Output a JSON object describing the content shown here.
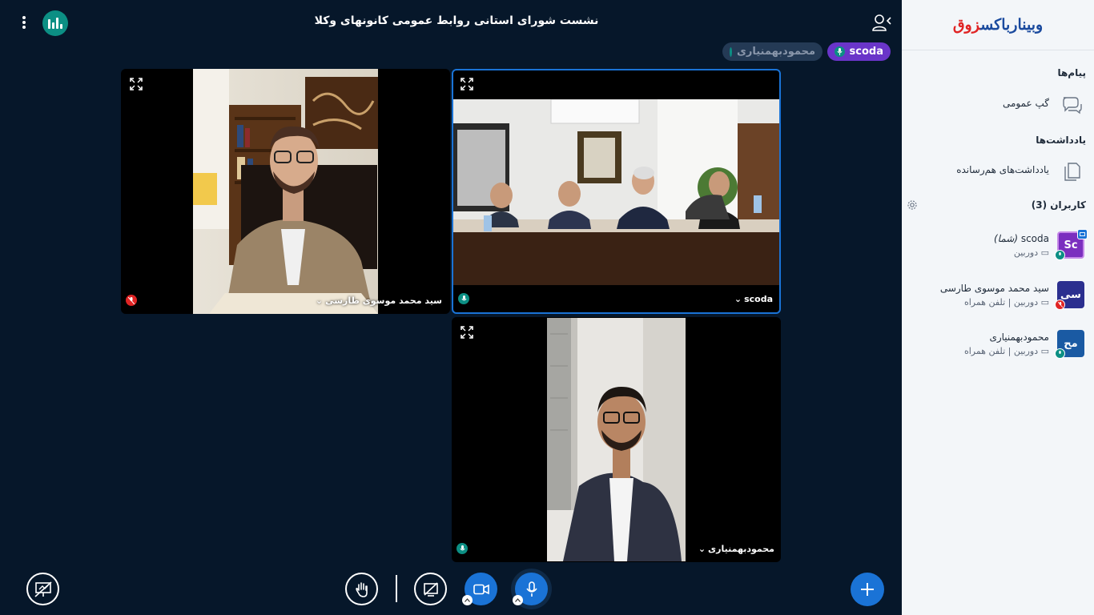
{
  "meeting": {
    "title": "نشست شورای استانی روابط عمومی کانونهای وکلا"
  },
  "talking": {
    "first": "scoda",
    "second": "محمودبهمنیاری"
  },
  "tiles": {
    "sayed": {
      "name": "سید محمد موسوی طارسی",
      "mic": "muted"
    },
    "scoda": {
      "name": "scoda",
      "mic": "on"
    },
    "mahmoud": {
      "name": "محمودبهمنیاری",
      "mic": "on"
    }
  },
  "sidebar": {
    "logo_main": "وبینارباکس",
    "logo_prefix": "زوق",
    "messages_title": "پیام‌ها",
    "public_chat": "گپ عمومی",
    "notes_title": "یادداشت‌ها",
    "shared_notes": "یادداشت‌های هم‌رسانده",
    "users_title": "کاربران (3)",
    "users": [
      {
        "initials": "Sc",
        "name": "scoda",
        "you": "(شما)",
        "sub": "دوربین",
        "color": "#7b2fbf"
      },
      {
        "initials": "سی",
        "name": "سید محمد موسوی طارسی",
        "sub": "دوربین | تلفن همراه",
        "color": "#2b2f8f"
      },
      {
        "initials": "مح",
        "name": "محمودبهمنیاری",
        "sub": "دوربین | تلفن همراه",
        "color": "#1a5aa3"
      }
    ]
  },
  "colors": {
    "accent": "#1a73d6",
    "talking_purple": "#6a35c9",
    "mic_green": "#0c8f84",
    "muted_red": "#e02424",
    "background": "#06172a"
  }
}
